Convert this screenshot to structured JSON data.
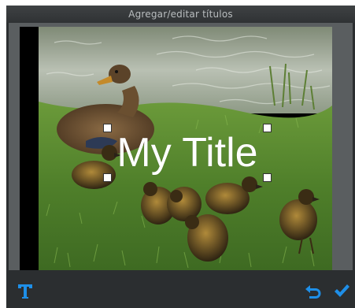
{
  "window": {
    "title": "Agregar/editar títulos"
  },
  "overlay": {
    "title_text": "My Title"
  },
  "toolbar": {
    "text_tool_icon": "text-tool-icon",
    "undo_icon": "undo-icon",
    "confirm_icon": "checkmark-icon"
  },
  "colors": {
    "accent": "#1e8fe8",
    "dialog_background": "#2b2e30",
    "titlebar_text": "#b9bdbf"
  }
}
